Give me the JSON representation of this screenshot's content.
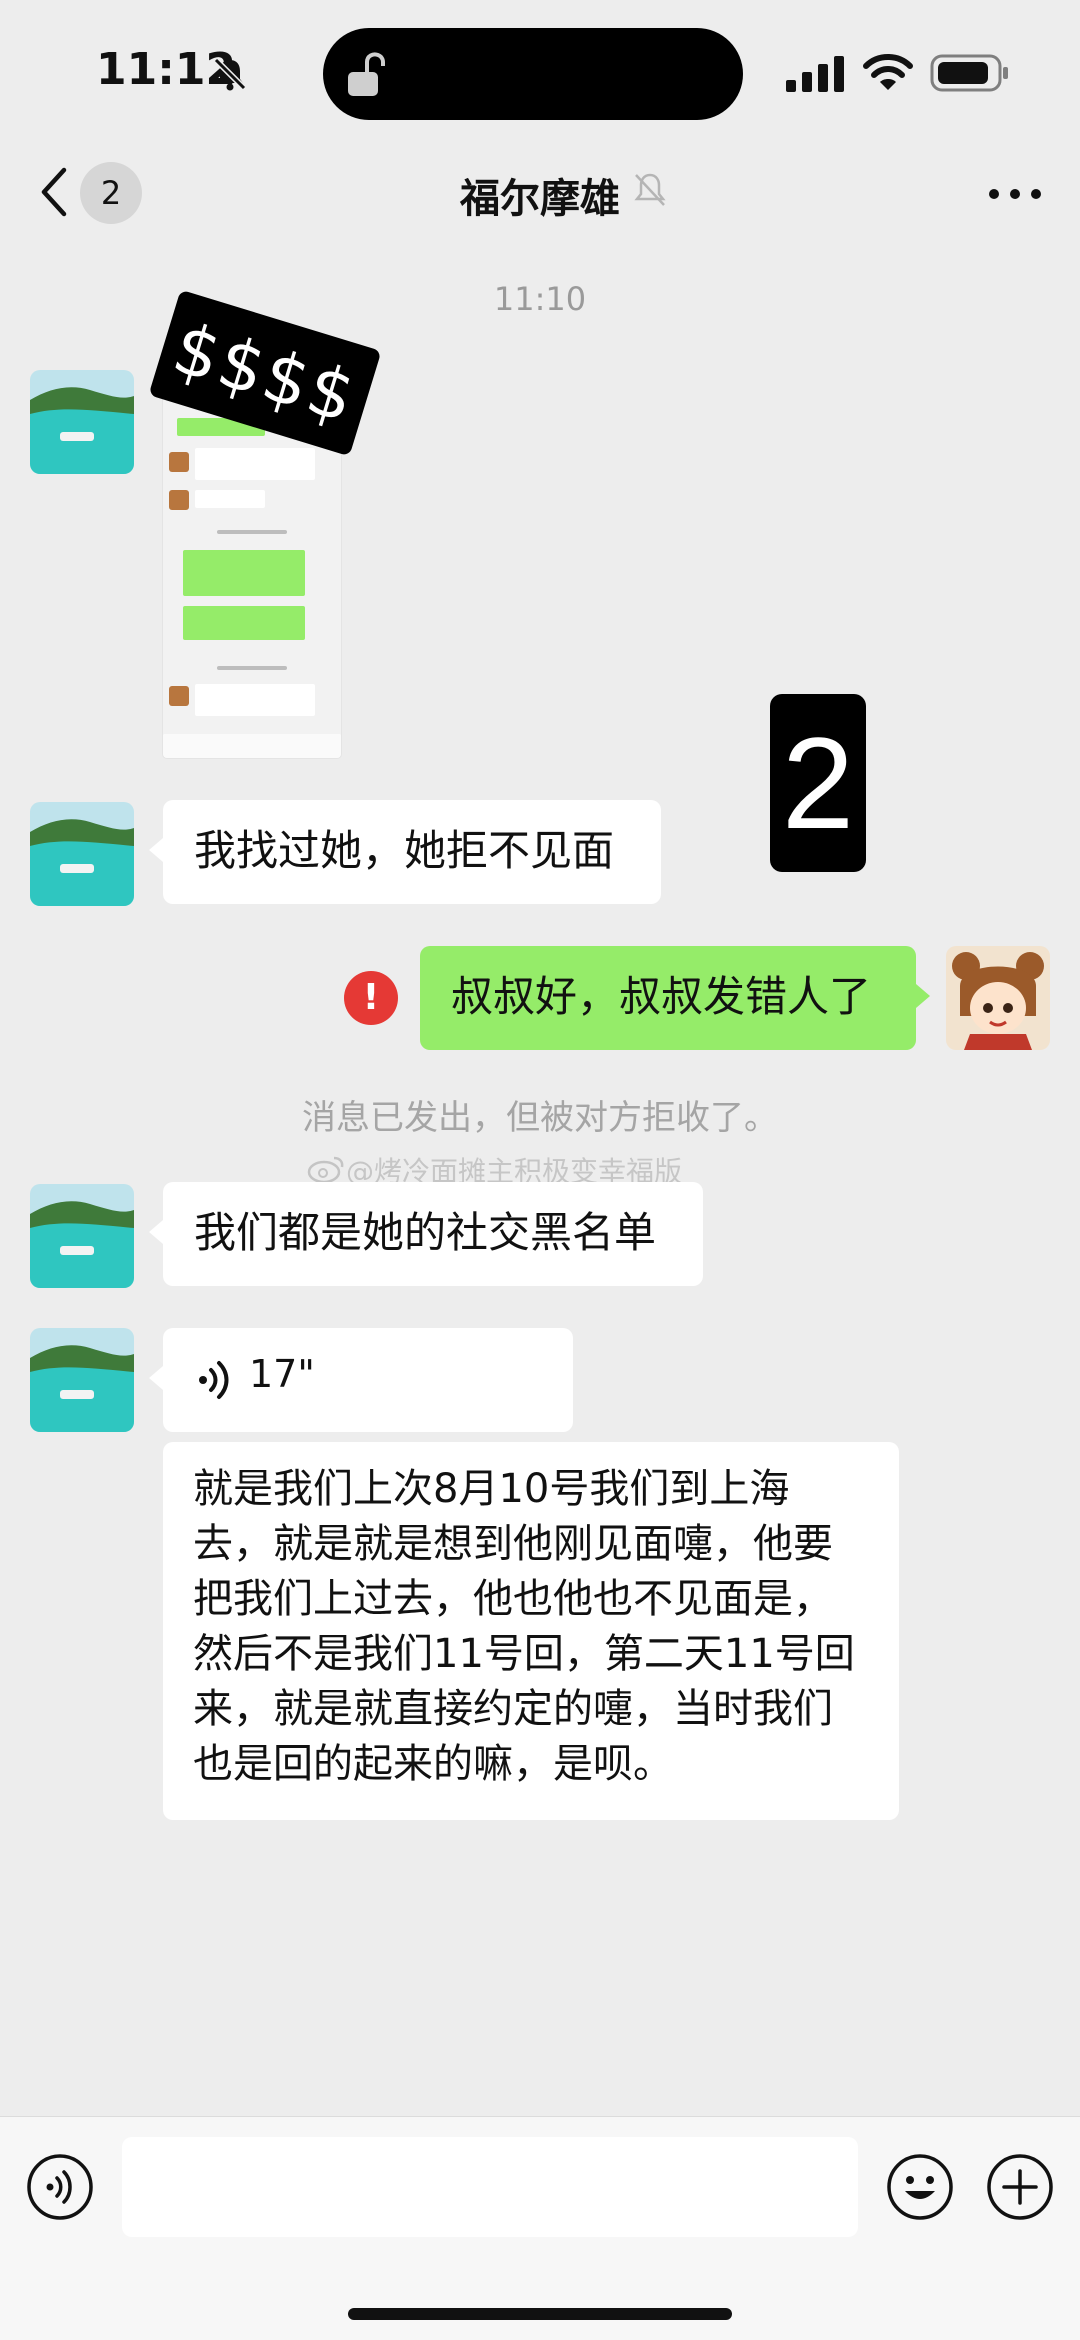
{
  "status_bar": {
    "time": "11:12"
  },
  "nav": {
    "back_count": "2",
    "title": "福尔摩雄"
  },
  "timestamp": "11:10",
  "messages": {
    "m1": "我找过她，她拒不见面",
    "m2_sent": "叔叔好，叔叔发错人了",
    "system": "消息已发出，但被对方拒收了。",
    "m3": "我们都是她的社交黑名单",
    "voice_duration": "17\"",
    "transcript": "就是我们上次8月10号我们到上海去，就是就是想到他刚见面嚏，他要把我们上过去，他也他也不见面是，然后不是我们11号回，第二天11号回来，就是就直接约定的嚏，当时我们也是回的起来的嘛，是呗。"
  },
  "stickers": {
    "dollars": "$$$$",
    "number": "2"
  },
  "watermark": "@烤冷面摊主积极变幸福版",
  "colors": {
    "background": "#ededed",
    "sent_bubble": "#95ec69",
    "received_bubble": "#ffffff",
    "error": "#e53935"
  },
  "icons": {
    "back": "chevron-left-icon",
    "mute": "bell-off-icon",
    "more": "ellipsis-icon",
    "voice": "voice-wave-icon",
    "emoji": "smiley-icon",
    "plus": "plus-circle-icon"
  }
}
